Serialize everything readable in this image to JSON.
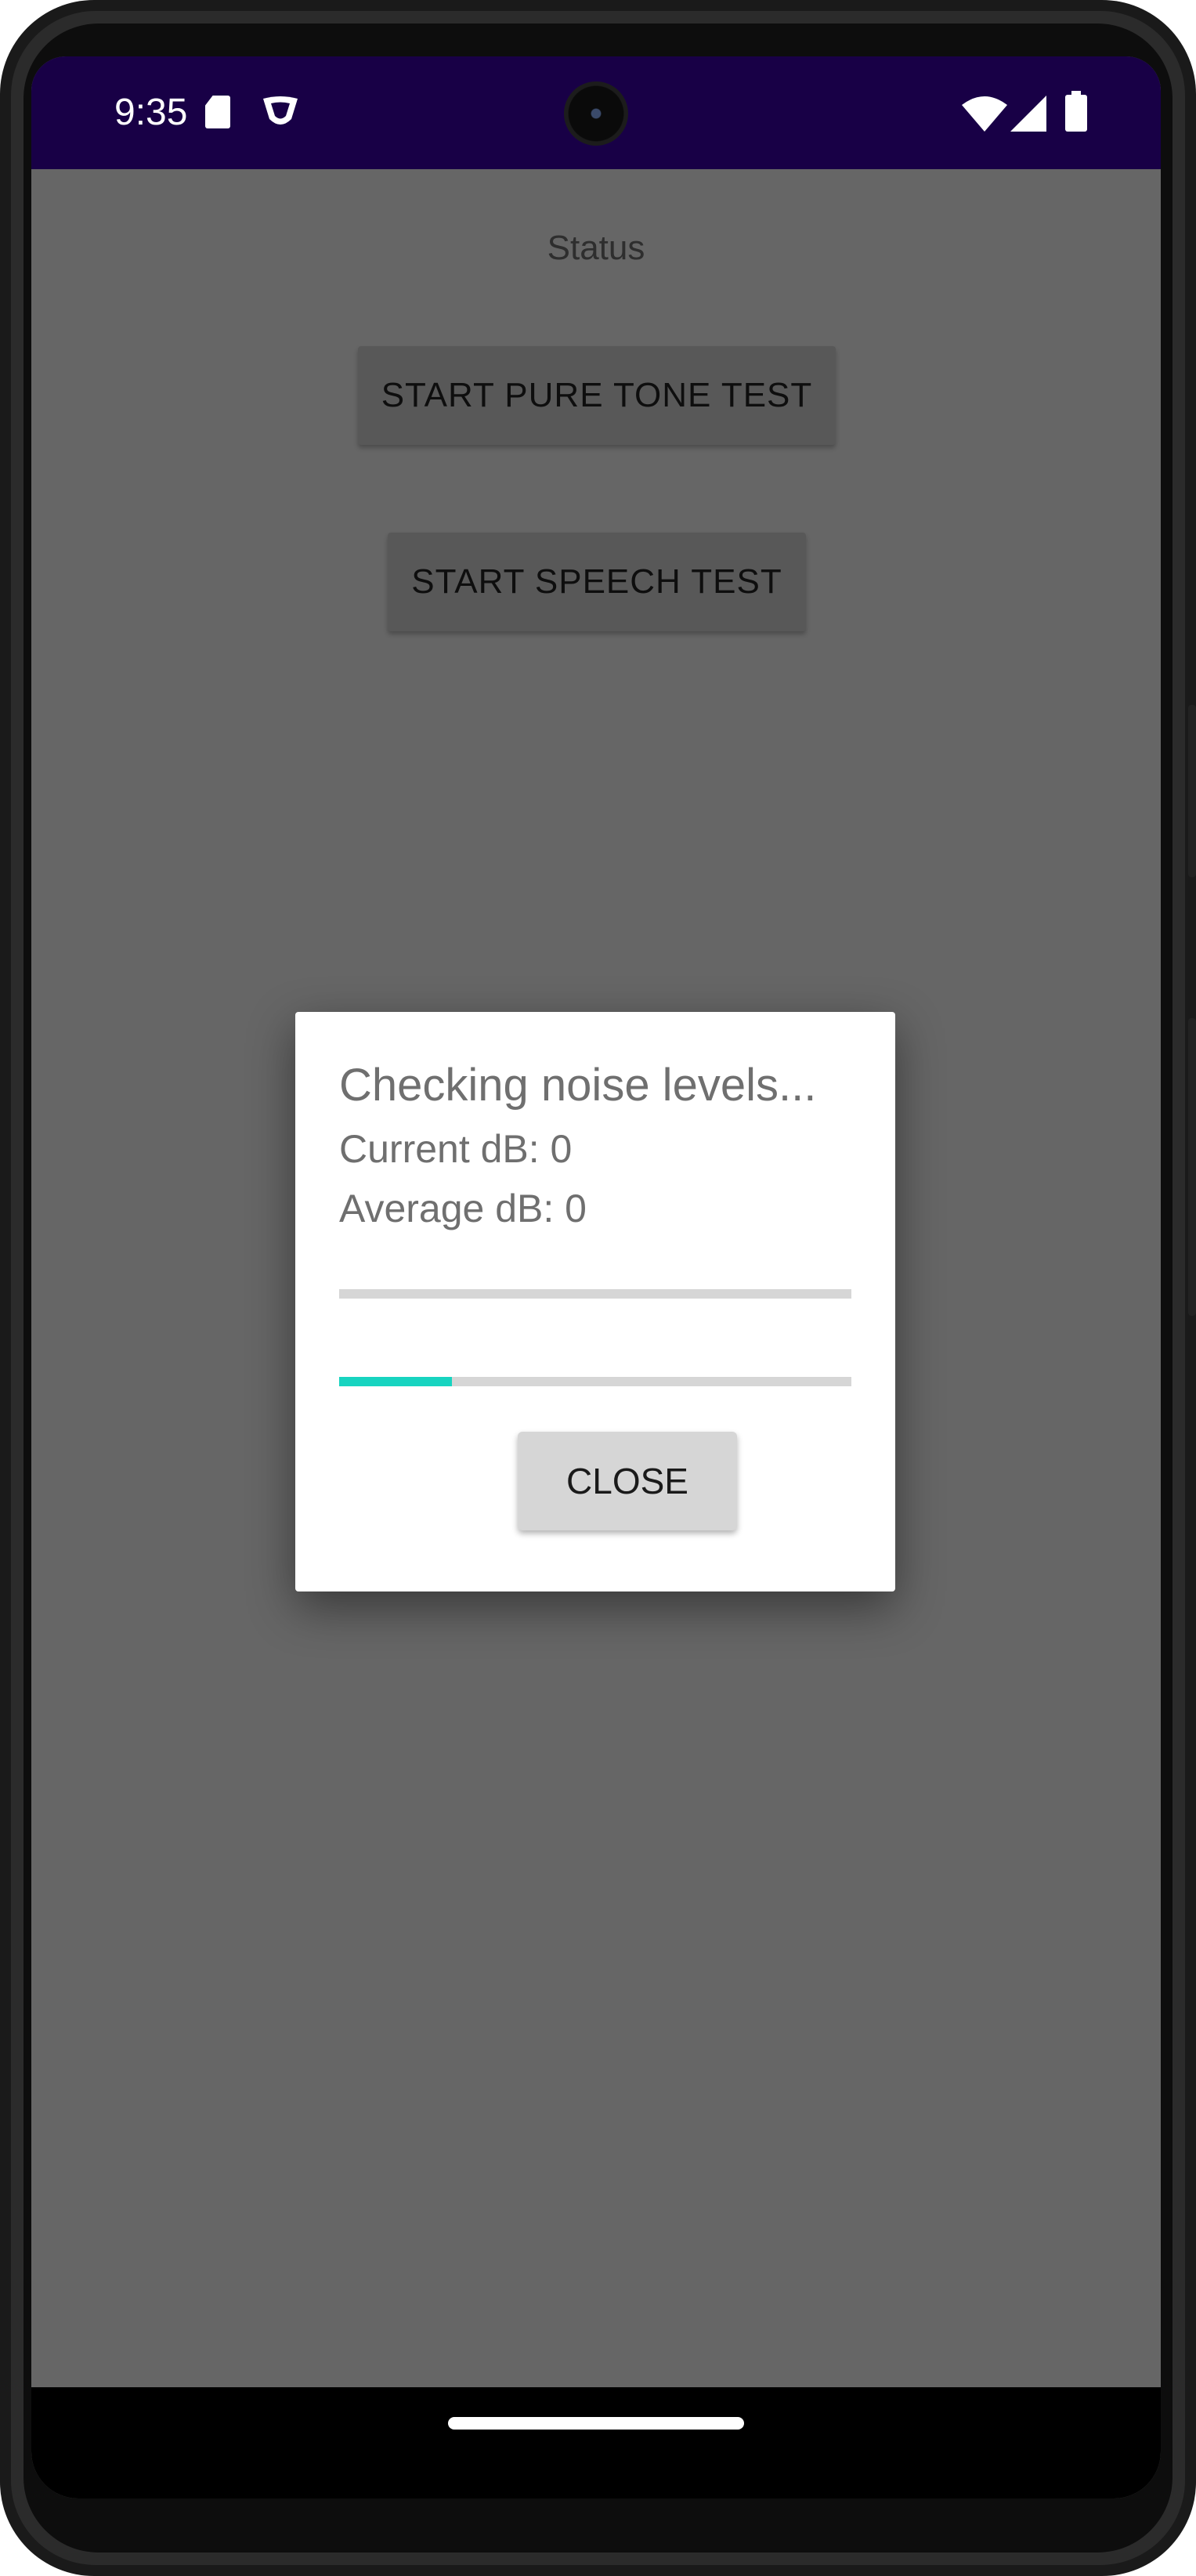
{
  "status_bar": {
    "time": "9:35",
    "icons": [
      "sd-card-icon",
      "vpn-shield-icon",
      "wifi-icon",
      "cellular-signal-icon",
      "battery-icon"
    ]
  },
  "main": {
    "status_label": "Status",
    "pure_tone_button_label": "START PURE TONE TEST",
    "speech_button_label": "START SPEECH TEST"
  },
  "dialog": {
    "title": "Checking noise levels...",
    "current_db": "Current dB: 0",
    "average_db": "Average dB: 0",
    "level_progress": 0.0,
    "timer_progress": 0.22,
    "close_label": "CLOSE",
    "accent_color": "#17d4c0"
  },
  "colors": {
    "status_bar": "#180046",
    "scrim_background": "#666666",
    "dialog_background": "#ffffff"
  }
}
